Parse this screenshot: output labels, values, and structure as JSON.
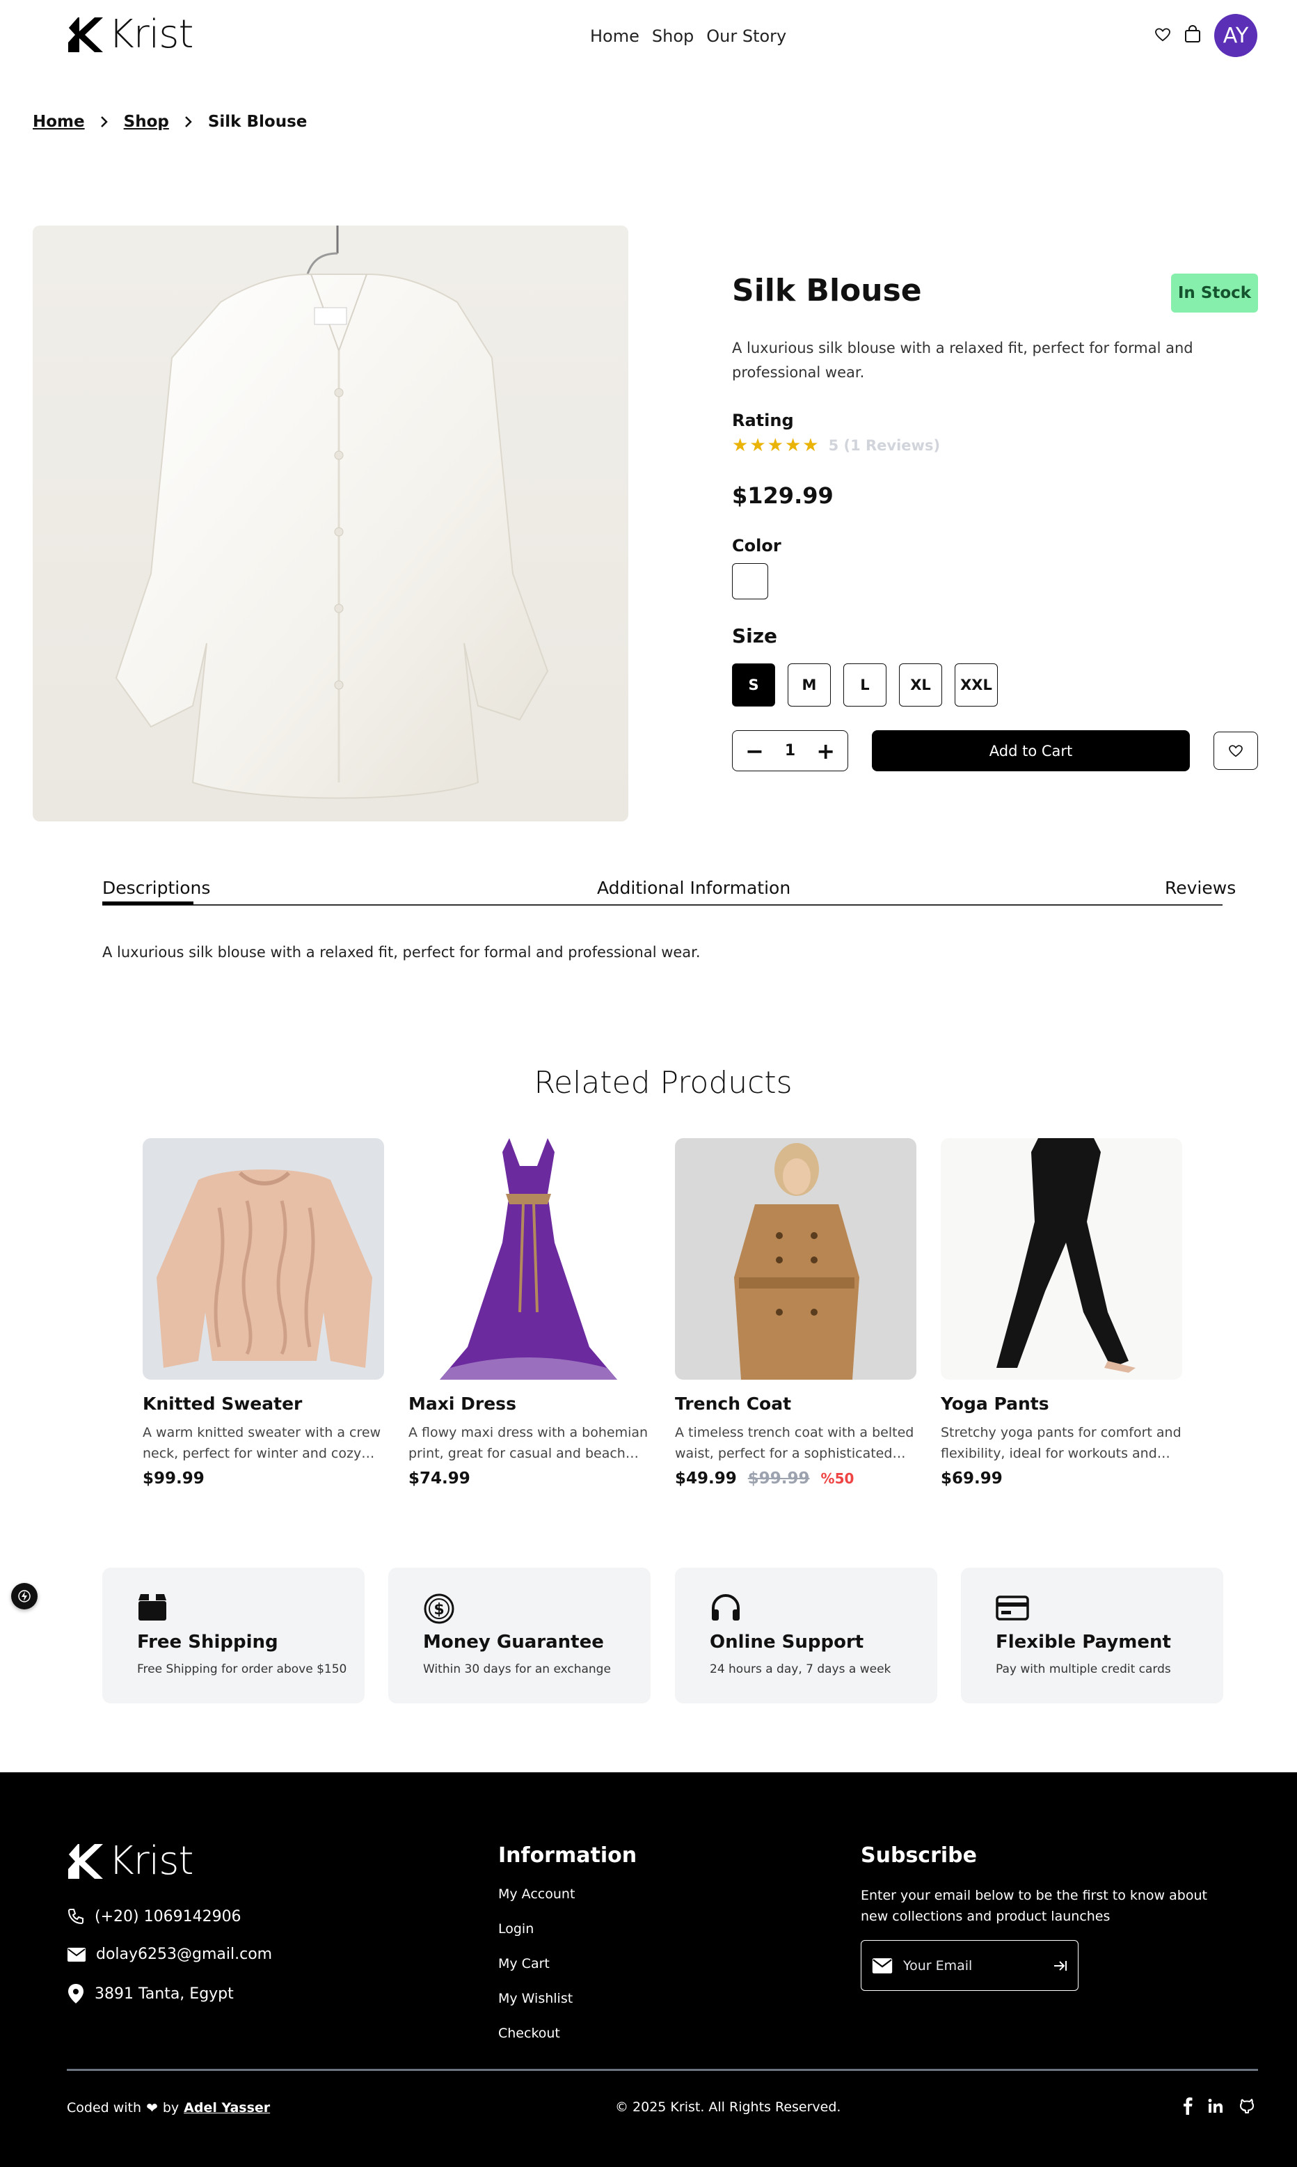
{
  "header": {
    "logo_text": "Krist",
    "nav": [
      "Home",
      "Shop",
      "Our Story"
    ],
    "avatar_initials": "AY"
  },
  "breadcrumb": {
    "home": "Home",
    "shop": "Shop",
    "current": "Silk Blouse"
  },
  "product": {
    "title": "Silk Blouse",
    "stock_badge": "In Stock",
    "description": "A luxurious silk blouse with a relaxed fit, perfect for formal and professional wear.",
    "rating_label": "Rating",
    "rating_stars": 5,
    "rating_text": "5 (1 Reviews)",
    "price": "$129.99",
    "color_label": "Color",
    "color_value": "#ffffff",
    "size_label": "Size",
    "sizes": [
      "S",
      "M",
      "L",
      "XL",
      "XXL"
    ],
    "selected_size": "S",
    "quantity": "1",
    "add_to_cart": "Add to Cart"
  },
  "tabs": {
    "items": [
      "Descriptions",
      "Additional Information",
      "Reviews"
    ],
    "active": "Descriptions",
    "content": "A luxurious silk blouse with a relaxed fit, perfect for formal and professional wear."
  },
  "related": {
    "title": "Related Products",
    "items": [
      {
        "name": "Knitted Sweater",
        "desc": "A warm knitted sweater with a crew neck, perfect for winter and cozy days. Soft and comfortable.",
        "price": "$99.99"
      },
      {
        "name": "Maxi Dress",
        "desc": "A flowy maxi dress with a bohemian print, great for casual and beach wear. Light and breezy.",
        "price": "$74.99"
      },
      {
        "name": "Trench Coat",
        "desc": "A timeless trench coat with a belted waist, perfect for a sophisticated and elegant look.",
        "price": "$49.99",
        "old_price": "$99.99",
        "discount": "%50"
      },
      {
        "name": "Yoga Pants",
        "desc": "Stretchy yoga pants for comfort and flexibility, ideal for workouts and casual wear.",
        "price": "$69.99"
      }
    ]
  },
  "features": [
    {
      "icon": "box-icon",
      "title": "Free Shipping",
      "sub": "Free Shipping for order above $150"
    },
    {
      "icon": "dollar-coin-icon",
      "title": "Money Guarantee",
      "sub": "Within 30 days for an exchange"
    },
    {
      "icon": "headphones-icon",
      "title": "Online Support",
      "sub": "24 hours a day, 7 days a week"
    },
    {
      "icon": "credit-card-icon",
      "title": "Flexible Payment",
      "sub": "Pay with multiple credit cards"
    }
  ],
  "footer": {
    "logo_text": "Krist",
    "phone": "(+20) 1069142906",
    "email": "dolay6253@gmail.com",
    "address": "3891 Tanta, Egypt",
    "info_title": "Information",
    "info_links": [
      "My Account",
      "Login",
      "My Cart",
      "My Wishlist",
      "Checkout"
    ],
    "subscribe_title": "Subscribe",
    "subscribe_text": "Enter your email below to be the first to know about new collections and product launches",
    "email_placeholder": "Your Email",
    "coded_with": "Coded with",
    "by": "by",
    "author": "Adel Yasser",
    "copyright": "© 2025 Krist. All Rights Reserved."
  },
  "colors": {
    "accent": "#5b2fb6",
    "stock": "#86efac",
    "star": "#eab308",
    "discount": "#ef4444"
  }
}
